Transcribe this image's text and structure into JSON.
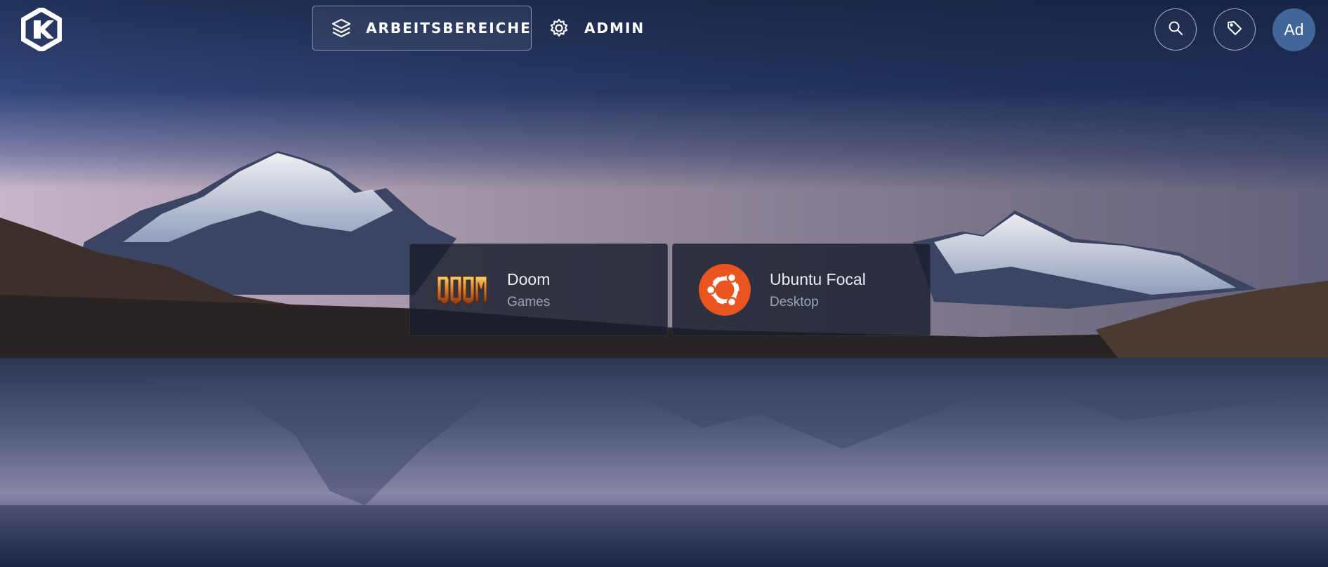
{
  "header": {
    "logo_icon": "kasm-logo-icon",
    "nav": [
      {
        "label": "ARBEITSBEREICHE",
        "icon": "layers-icon"
      },
      {
        "label": "ADMIN",
        "icon": "gear-icon"
      }
    ],
    "search_icon": "search-icon",
    "tags_icon": "tag-icon",
    "avatar_initials": "Ad"
  },
  "workspaces": [
    {
      "name": "Doom",
      "category": "Games",
      "icon": "doom-logo-icon"
    },
    {
      "name": "Ubuntu Focal",
      "category": "Desktop",
      "icon": "ubuntu-logo-icon"
    }
  ],
  "colors": {
    "accent": "#41679a",
    "ubuntu_orange": "#e95420",
    "card_bg": "#1a1e2c"
  }
}
